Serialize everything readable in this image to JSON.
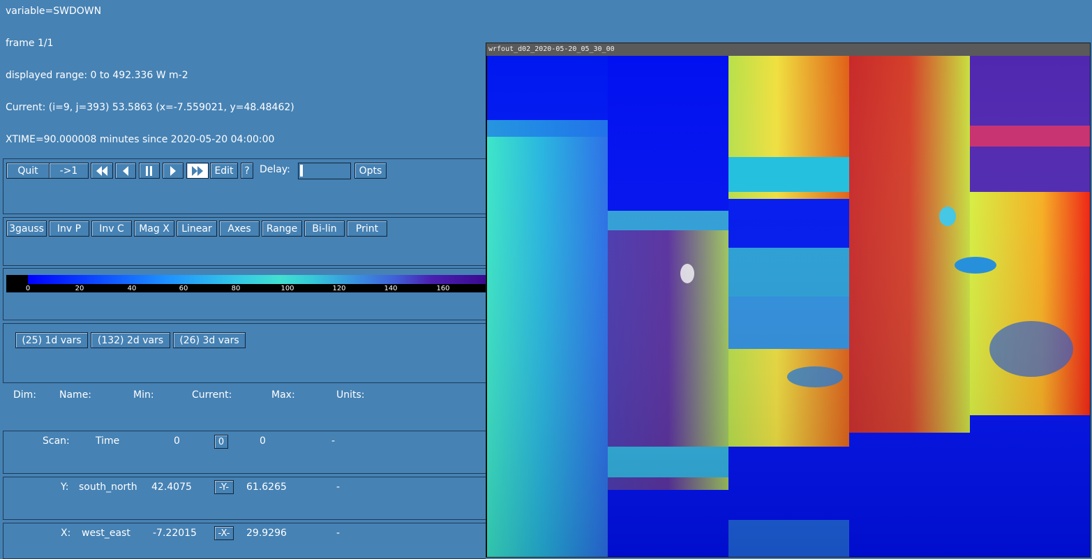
{
  "info": {
    "variable": "variable=SWDOWN",
    "frame": "frame 1/1",
    "range": "displayed range: 0 to 492.336 W m-2",
    "current": "Current: (i=9, j=393) 53.5863 (x=-7.559021, y=48.48462)",
    "xtime": "XTIME=90.000008 minutes since 2020-05-20 04:00:00"
  },
  "controls": {
    "quit": "Quit",
    "to_one": "->1",
    "edit": "Edit",
    "help": "?",
    "delay_label": "Delay:",
    "opts": "Opts"
  },
  "options": {
    "colormap": "3gauss",
    "inv_p": "Inv P",
    "inv_c": "Inv C",
    "mag_x": "Mag X",
    "linear": "Linear",
    "axes": "Axes",
    "range": "Range",
    "bilin": "Bi-lin",
    "print": "Print"
  },
  "colorbar": {
    "ticks": [
      "0",
      "20",
      "40",
      "60",
      "80",
      "100",
      "120",
      "140",
      "160"
    ]
  },
  "vars": {
    "one_d": "(25) 1d vars",
    "two_d": "(132) 2d vars",
    "three_d": "(26) 3d vars"
  },
  "dim_table": {
    "headers": {
      "dim": "Dim:",
      "name": "Name:",
      "min": "Min:",
      "current": "Current:",
      "max": "Max:",
      "units": "Units:"
    },
    "rows": [
      {
        "dim": "Scan:",
        "name": "Time",
        "min": "0",
        "current": "0",
        "max": "0",
        "units": "-"
      },
      {
        "dim": "Y:",
        "name": "south_north",
        "min": "42.4075",
        "current": "-Y-",
        "max": "61.6265",
        "units": "-"
      },
      {
        "dim": "X:",
        "name": "west_east",
        "min": "-7.22015",
        "current": "-X-",
        "max": "29.9296",
        "units": "-"
      }
    ]
  },
  "plot": {
    "title": "wrfout_d02_2020-05-20_05_30_00"
  },
  "colors": {
    "background": "#4682b4",
    "text": "#ffffff"
  }
}
